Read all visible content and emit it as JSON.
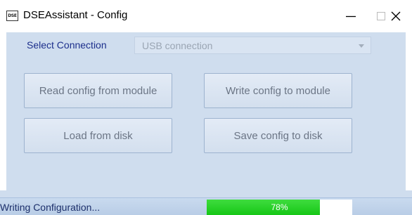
{
  "window": {
    "icon_text": "DSE",
    "title": "DSEAssistant - Config",
    "controls": {
      "minimize": "minimize",
      "maximize": "maximize",
      "close": "close"
    }
  },
  "connection": {
    "label": "Select Connection",
    "selected": "USB connection"
  },
  "buttons": {
    "read": "Read config from module",
    "write": "Write config to module",
    "load": "Load from disk",
    "save": "Save config to disk"
  },
  "status": {
    "text": "Writing Configuration...",
    "progress_label": "78%",
    "progress_fraction": 0.78,
    "progress_color": "#22cc22"
  }
}
